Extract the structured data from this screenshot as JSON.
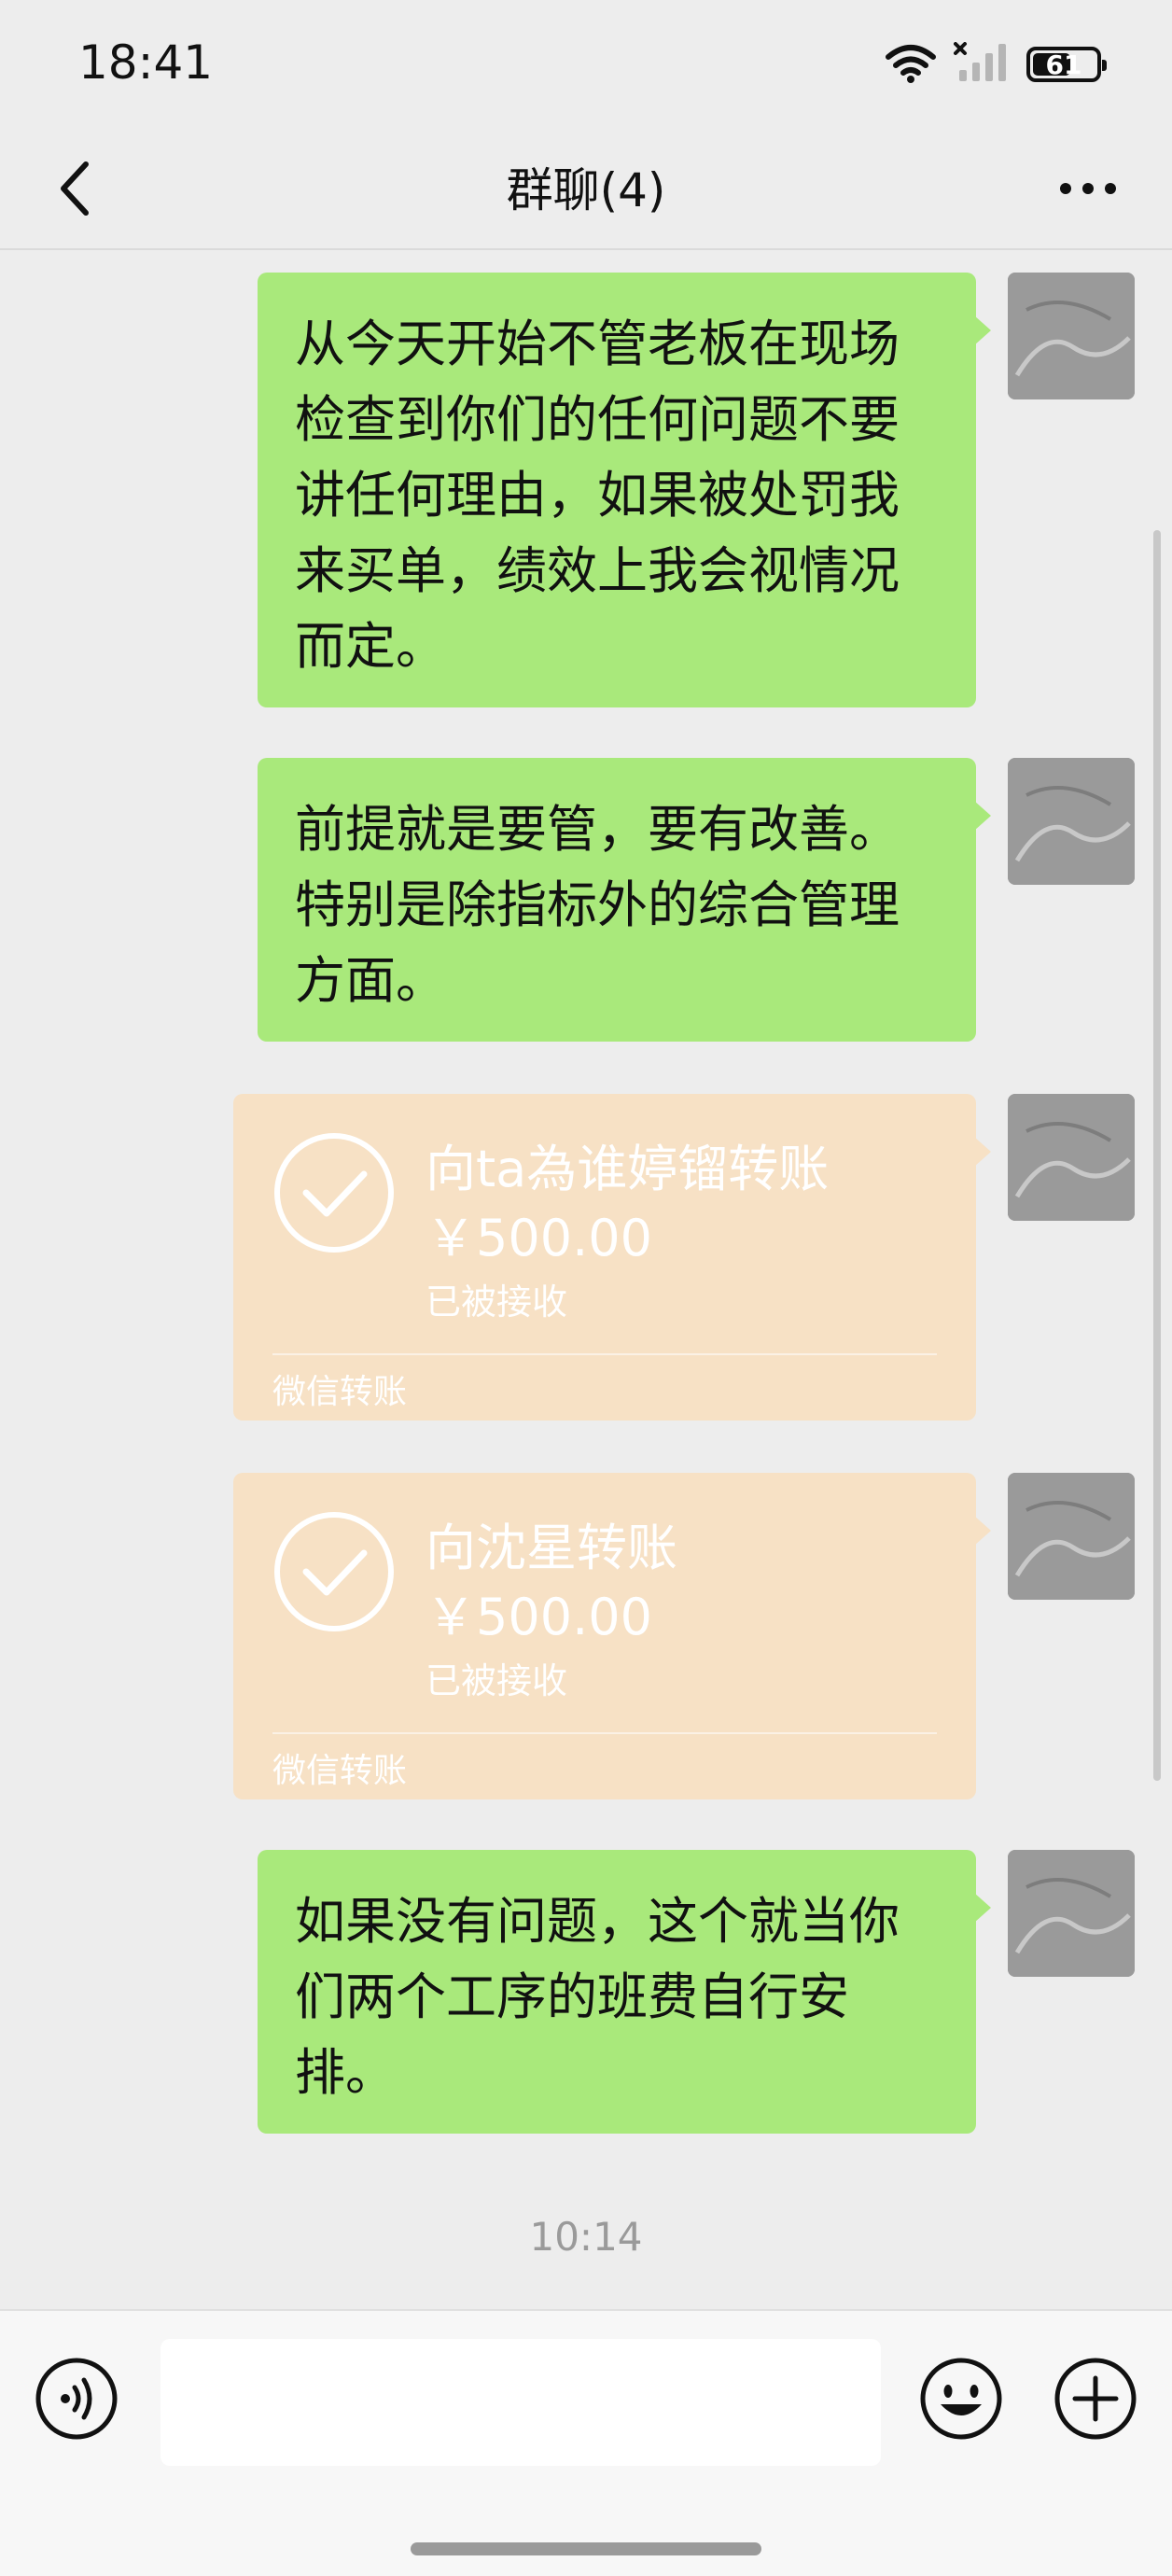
{
  "status_bar": {
    "time": "18:41",
    "battery": "61",
    "battery_level": 0.61,
    "icons": [
      "wifi-icon",
      "signal-no-sim-icon",
      "battery-icon"
    ]
  },
  "nav": {
    "title": "群聊(4)",
    "back_icon": "chevron-left-icon",
    "more_icon": "more-dots-icon"
  },
  "messages": [
    {
      "type": "text",
      "text": "从今天开始不管老板在现场检查到你们的任何问题不要讲任何理由，如果被处罚我来买单，绩效上我会视情况而定。"
    },
    {
      "type": "text",
      "text": "前提就是要管，要有改善。特别是除指标外的综合管理方面。"
    },
    {
      "type": "transfer",
      "title": "向ta為谁婷镏转账",
      "amount": "￥500.00",
      "status": "已被接收",
      "footer": "微信转账"
    },
    {
      "type": "transfer",
      "title": "向沈星转账",
      "amount": "￥500.00",
      "status": "已被接收",
      "footer": "微信转账"
    },
    {
      "type": "text",
      "text": "如果没有问题，这个就当你们两个工序的班费自行安排。"
    }
  ],
  "timestamp": "10:14",
  "input_bar": {
    "value": "",
    "placeholder": "",
    "voice_icon": "voice-icon",
    "emoji_icon": "emoji-icon",
    "plus_icon": "plus-icon"
  },
  "colors": {
    "background": "#ededed",
    "bubble_self": "#a9e97b",
    "transfer_card": "#f7e1c5",
    "timestamp": "#9a9a9a"
  }
}
